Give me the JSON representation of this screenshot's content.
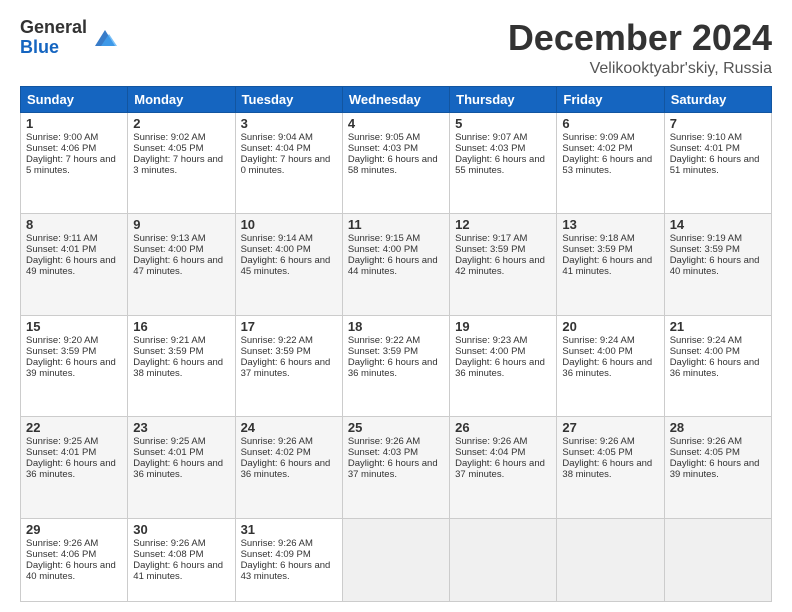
{
  "logo": {
    "general": "General",
    "blue": "Blue"
  },
  "title": "December 2024",
  "location": "Velikooktyabr'skiy, Russia",
  "days_header": [
    "Sunday",
    "Monday",
    "Tuesday",
    "Wednesday",
    "Thursday",
    "Friday",
    "Saturday"
  ],
  "weeks": [
    [
      {
        "day": "1",
        "sunrise": "Sunrise: 9:00 AM",
        "sunset": "Sunset: 4:06 PM",
        "daylight": "Daylight: 7 hours and 5 minutes."
      },
      {
        "day": "2",
        "sunrise": "Sunrise: 9:02 AM",
        "sunset": "Sunset: 4:05 PM",
        "daylight": "Daylight: 7 hours and 3 minutes."
      },
      {
        "day": "3",
        "sunrise": "Sunrise: 9:04 AM",
        "sunset": "Sunset: 4:04 PM",
        "daylight": "Daylight: 7 hours and 0 minutes."
      },
      {
        "day": "4",
        "sunrise": "Sunrise: 9:05 AM",
        "sunset": "Sunset: 4:03 PM",
        "daylight": "Daylight: 6 hours and 58 minutes."
      },
      {
        "day": "5",
        "sunrise": "Sunrise: 9:07 AM",
        "sunset": "Sunset: 4:03 PM",
        "daylight": "Daylight: 6 hours and 55 minutes."
      },
      {
        "day": "6",
        "sunrise": "Sunrise: 9:09 AM",
        "sunset": "Sunset: 4:02 PM",
        "daylight": "Daylight: 6 hours and 53 minutes."
      },
      {
        "day": "7",
        "sunrise": "Sunrise: 9:10 AM",
        "sunset": "Sunset: 4:01 PM",
        "daylight": "Daylight: 6 hours and 51 minutes."
      }
    ],
    [
      {
        "day": "8",
        "sunrise": "Sunrise: 9:11 AM",
        "sunset": "Sunset: 4:01 PM",
        "daylight": "Daylight: 6 hours and 49 minutes."
      },
      {
        "day": "9",
        "sunrise": "Sunrise: 9:13 AM",
        "sunset": "Sunset: 4:00 PM",
        "daylight": "Daylight: 6 hours and 47 minutes."
      },
      {
        "day": "10",
        "sunrise": "Sunrise: 9:14 AM",
        "sunset": "Sunset: 4:00 PM",
        "daylight": "Daylight: 6 hours and 45 minutes."
      },
      {
        "day": "11",
        "sunrise": "Sunrise: 9:15 AM",
        "sunset": "Sunset: 4:00 PM",
        "daylight": "Daylight: 6 hours and 44 minutes."
      },
      {
        "day": "12",
        "sunrise": "Sunrise: 9:17 AM",
        "sunset": "Sunset: 3:59 PM",
        "daylight": "Daylight: 6 hours and 42 minutes."
      },
      {
        "day": "13",
        "sunrise": "Sunrise: 9:18 AM",
        "sunset": "Sunset: 3:59 PM",
        "daylight": "Daylight: 6 hours and 41 minutes."
      },
      {
        "day": "14",
        "sunrise": "Sunrise: 9:19 AM",
        "sunset": "Sunset: 3:59 PM",
        "daylight": "Daylight: 6 hours and 40 minutes."
      }
    ],
    [
      {
        "day": "15",
        "sunrise": "Sunrise: 9:20 AM",
        "sunset": "Sunset: 3:59 PM",
        "daylight": "Daylight: 6 hours and 39 minutes."
      },
      {
        "day": "16",
        "sunrise": "Sunrise: 9:21 AM",
        "sunset": "Sunset: 3:59 PM",
        "daylight": "Daylight: 6 hours and 38 minutes."
      },
      {
        "day": "17",
        "sunrise": "Sunrise: 9:22 AM",
        "sunset": "Sunset: 3:59 PM",
        "daylight": "Daylight: 6 hours and 37 minutes."
      },
      {
        "day": "18",
        "sunrise": "Sunrise: 9:22 AM",
        "sunset": "Sunset: 3:59 PM",
        "daylight": "Daylight: 6 hours and 36 minutes."
      },
      {
        "day": "19",
        "sunrise": "Sunrise: 9:23 AM",
        "sunset": "Sunset: 4:00 PM",
        "daylight": "Daylight: 6 hours and 36 minutes."
      },
      {
        "day": "20",
        "sunrise": "Sunrise: 9:24 AM",
        "sunset": "Sunset: 4:00 PM",
        "daylight": "Daylight: 6 hours and 36 minutes."
      },
      {
        "day": "21",
        "sunrise": "Sunrise: 9:24 AM",
        "sunset": "Sunset: 4:00 PM",
        "daylight": "Daylight: 6 hours and 36 minutes."
      }
    ],
    [
      {
        "day": "22",
        "sunrise": "Sunrise: 9:25 AM",
        "sunset": "Sunset: 4:01 PM",
        "daylight": "Daylight: 6 hours and 36 minutes."
      },
      {
        "day": "23",
        "sunrise": "Sunrise: 9:25 AM",
        "sunset": "Sunset: 4:01 PM",
        "daylight": "Daylight: 6 hours and 36 minutes."
      },
      {
        "day": "24",
        "sunrise": "Sunrise: 9:26 AM",
        "sunset": "Sunset: 4:02 PM",
        "daylight": "Daylight: 6 hours and 36 minutes."
      },
      {
        "day": "25",
        "sunrise": "Sunrise: 9:26 AM",
        "sunset": "Sunset: 4:03 PM",
        "daylight": "Daylight: 6 hours and 37 minutes."
      },
      {
        "day": "26",
        "sunrise": "Sunrise: 9:26 AM",
        "sunset": "Sunset: 4:04 PM",
        "daylight": "Daylight: 6 hours and 37 minutes."
      },
      {
        "day": "27",
        "sunrise": "Sunrise: 9:26 AM",
        "sunset": "Sunset: 4:05 PM",
        "daylight": "Daylight: 6 hours and 38 minutes."
      },
      {
        "day": "28",
        "sunrise": "Sunrise: 9:26 AM",
        "sunset": "Sunset: 4:05 PM",
        "daylight": "Daylight: 6 hours and 39 minutes."
      }
    ],
    [
      {
        "day": "29",
        "sunrise": "Sunrise: 9:26 AM",
        "sunset": "Sunset: 4:06 PM",
        "daylight": "Daylight: 6 hours and 40 minutes."
      },
      {
        "day": "30",
        "sunrise": "Sunrise: 9:26 AM",
        "sunset": "Sunset: 4:08 PM",
        "daylight": "Daylight: 6 hours and 41 minutes."
      },
      {
        "day": "31",
        "sunrise": "Sunrise: 9:26 AM",
        "sunset": "Sunset: 4:09 PM",
        "daylight": "Daylight: 6 hours and 43 minutes."
      },
      null,
      null,
      null,
      null
    ]
  ]
}
